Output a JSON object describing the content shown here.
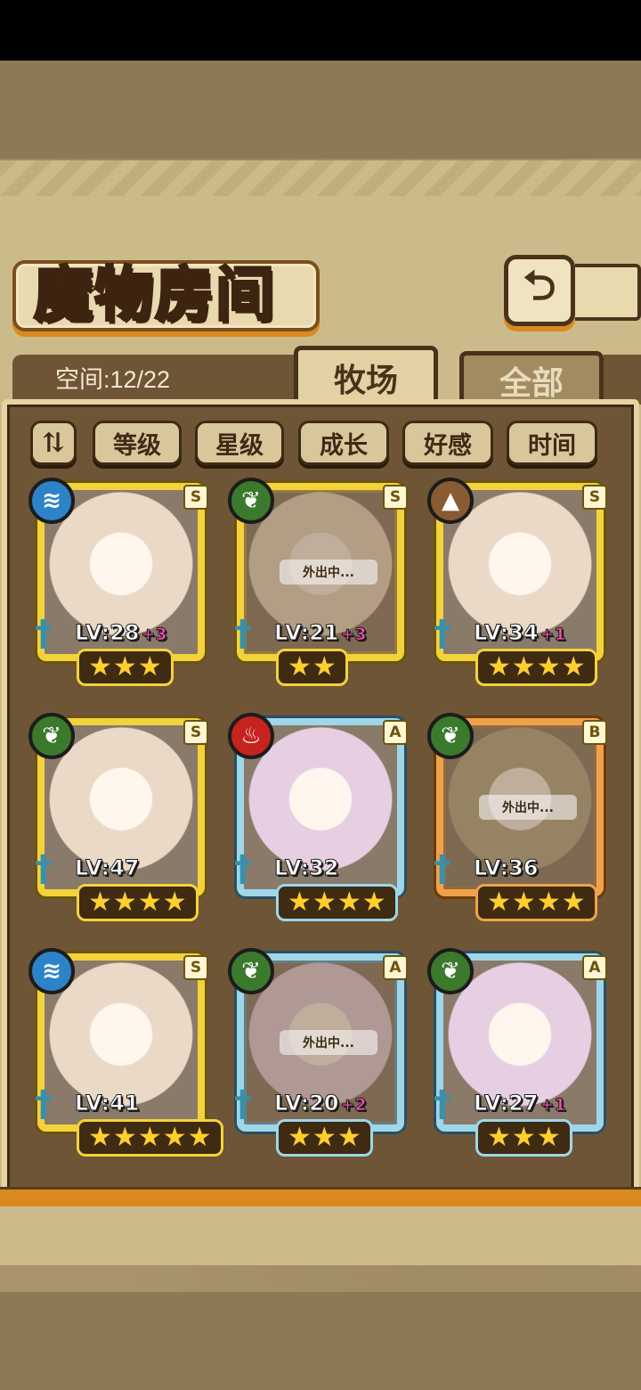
{
  "title": "魔物房间",
  "space_label": "空间:12/22",
  "tabs": [
    {
      "label": "牧场",
      "active": true
    },
    {
      "label": "全部",
      "active": false
    }
  ],
  "sort_toggle_icon": "sort-order-icon",
  "sort_buttons": [
    "等级",
    "星级",
    "成长",
    "好感",
    "时间"
  ],
  "away_text": "外出中...",
  "monsters": [
    {
      "element": "water",
      "rank": "S",
      "level": "LV:28",
      "bonus": "+3",
      "stars": 3,
      "frame": "gold",
      "away": false
    },
    {
      "element": "grass",
      "rank": "S",
      "level": "LV:21",
      "bonus": "+3",
      "stars": 2,
      "frame": "gold",
      "away": true
    },
    {
      "element": "earth",
      "rank": "S",
      "level": "LV:34",
      "bonus": "+1",
      "stars": 4,
      "frame": "gold",
      "away": false
    },
    {
      "element": "grass",
      "rank": "S",
      "level": "LV:47",
      "bonus": "",
      "stars": 4,
      "frame": "gold",
      "away": false
    },
    {
      "element": "fire",
      "rank": "A",
      "level": "LV:32",
      "bonus": "",
      "stars": 4,
      "frame": "blue",
      "away": false
    },
    {
      "element": "grass",
      "rank": "B",
      "level": "LV:36",
      "bonus": "",
      "stars": 4,
      "frame": "orange",
      "away": true
    },
    {
      "element": "water",
      "rank": "S",
      "level": "LV:41",
      "bonus": "",
      "stars": 5,
      "frame": "gold",
      "away": false
    },
    {
      "element": "grass",
      "rank": "A",
      "level": "LV:20",
      "bonus": "+2",
      "stars": 3,
      "frame": "blue",
      "away": true
    },
    {
      "element": "grass",
      "rank": "A",
      "level": "LV:27",
      "bonus": "+1",
      "stars": 3,
      "frame": "blue",
      "away": false
    }
  ],
  "colors": {
    "frame_gold": "#f3d33a",
    "frame_blue": "#9fd6e8",
    "frame_orange": "#f0a24b",
    "bonus_pink": "#ff4fb0",
    "star_yellow": "#ffcf2e"
  }
}
